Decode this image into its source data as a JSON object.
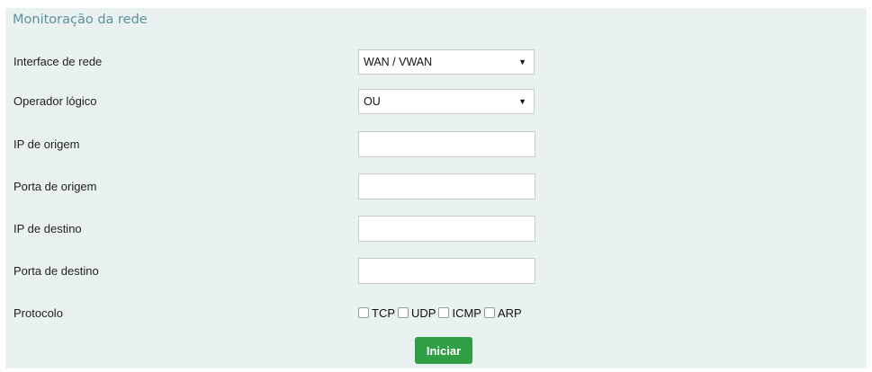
{
  "panel": {
    "title": "Monitoração da rede"
  },
  "fields": {
    "interface": {
      "label": "Interface de rede",
      "value": "WAN / VWAN"
    },
    "operator": {
      "label": "Operador lógico",
      "value": "OU"
    },
    "source_ip": {
      "label": "IP de origem",
      "value": ""
    },
    "source_port": {
      "label": "Porta de origem",
      "value": ""
    },
    "dest_ip": {
      "label": "IP de destino",
      "value": ""
    },
    "dest_port": {
      "label": "Porta de destino",
      "value": ""
    }
  },
  "protocol": {
    "label": "Protocolo",
    "options": [
      {
        "label": "TCP",
        "checked": false
      },
      {
        "label": "UDP",
        "checked": false
      },
      {
        "label": "ICMP",
        "checked": false
      },
      {
        "label": "ARP",
        "checked": false
      }
    ]
  },
  "actions": {
    "start_label": "Iniciar"
  },
  "icons": {
    "dropdown": "triangle-down-icon"
  },
  "colors": {
    "panel_background": "#eaf1f1",
    "title": "#5f8f9a",
    "button": "#2f9e45"
  }
}
